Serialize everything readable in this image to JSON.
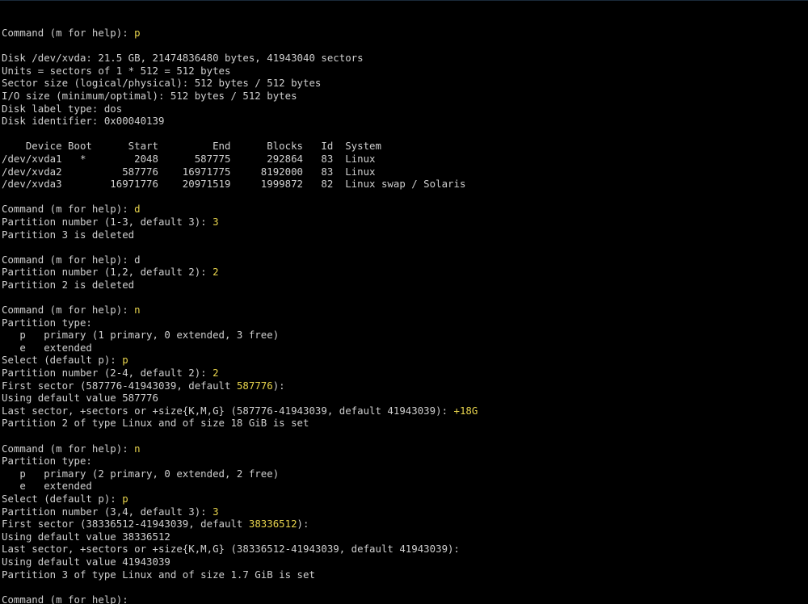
{
  "colors": {
    "background": "#000000",
    "text": "#cfcfcf",
    "user_input": "#e8d44d"
  },
  "lines": [
    {
      "text": "Command (m for help): ",
      "input": "p"
    },
    {
      "text": "",
      "input": ""
    },
    {
      "text": "Disk /dev/xvda: 21.5 GB, 21474836480 bytes, 41943040 sectors",
      "input": ""
    },
    {
      "text": "Units = sectors of 1 * 512 = 512 bytes",
      "input": ""
    },
    {
      "text": "Sector size (logical/physical): 512 bytes / 512 bytes",
      "input": ""
    },
    {
      "text": "I/O size (minimum/optimal): 512 bytes / 512 bytes",
      "input": ""
    },
    {
      "text": "Disk label type: dos",
      "input": ""
    },
    {
      "text": "Disk identifier: 0x00040139",
      "input": ""
    },
    {
      "text": "",
      "input": ""
    },
    {
      "text": "    Device Boot      Start         End      Blocks   Id  System",
      "input": ""
    },
    {
      "text": "/dev/xvda1   *        2048      587775      292864   83  Linux",
      "input": ""
    },
    {
      "text": "/dev/xvda2          587776    16971775     8192000   83  Linux",
      "input": ""
    },
    {
      "text": "/dev/xvda3        16971776    20971519     1999872   82  Linux swap / Solaris",
      "input": ""
    },
    {
      "text": "",
      "input": ""
    },
    {
      "text": "Command (m for help): ",
      "input": "d"
    },
    {
      "text": "Partition number (1-3, default 3): ",
      "input": "3"
    },
    {
      "text": "Partition 3 is deleted",
      "input": ""
    },
    {
      "text": "",
      "input": ""
    },
    {
      "text": "Command (m for help): d",
      "input": ""
    },
    {
      "text": "Partition number (1,2, default 2): ",
      "input": "2"
    },
    {
      "text": "Partition 2 is deleted",
      "input": ""
    },
    {
      "text": "",
      "input": ""
    },
    {
      "text": "Command (m for help): ",
      "input": "n"
    },
    {
      "text": "Partition type:",
      "input": ""
    },
    {
      "text": "   p   primary (1 primary, 0 extended, 3 free)",
      "input": ""
    },
    {
      "text": "   e   extended",
      "input": ""
    },
    {
      "text": "Select (default p): ",
      "input": "p"
    },
    {
      "text": "Partition number (2-4, default 2): ",
      "input": "2"
    },
    {
      "text": "First sector (587776-41943039, default ",
      "input": "587776",
      "after": "):"
    },
    {
      "text": "Using default value 587776",
      "input": ""
    },
    {
      "text": "Last sector, +sectors or +size{K,M,G} (587776-41943039, default 41943039): ",
      "input": "+18G"
    },
    {
      "text": "Partition 2 of type Linux and of size 18 GiB is set",
      "input": ""
    },
    {
      "text": "",
      "input": ""
    },
    {
      "text": "Command (m for help): ",
      "input": "n"
    },
    {
      "text": "Partition type:",
      "input": ""
    },
    {
      "text": "   p   primary (2 primary, 0 extended, 2 free)",
      "input": ""
    },
    {
      "text": "   e   extended",
      "input": ""
    },
    {
      "text": "Select (default p): ",
      "input": "p"
    },
    {
      "text": "Partition number (3,4, default 3): ",
      "input": "3"
    },
    {
      "text": "First sector (38336512-41943039, default ",
      "input": "38336512",
      "after": "):"
    },
    {
      "text": "Using default value 38336512",
      "input": ""
    },
    {
      "text": "Last sector, +sectors or +size{K,M,G} (38336512-41943039, default 41943039):",
      "input": ""
    },
    {
      "text": "Using default value 41943039",
      "input": ""
    },
    {
      "text": "Partition 3 of type Linux and of size 1.7 GiB is set",
      "input": ""
    },
    {
      "text": "",
      "input": ""
    },
    {
      "text": "Command (m for help):",
      "input": ""
    }
  ]
}
